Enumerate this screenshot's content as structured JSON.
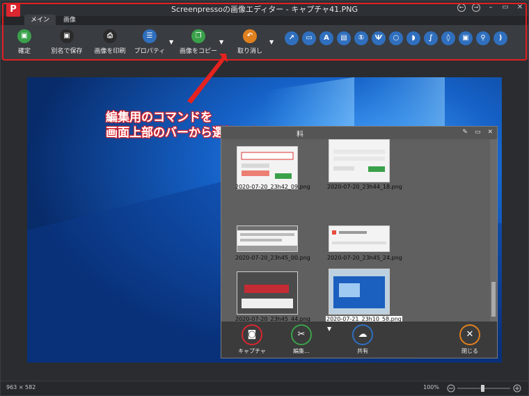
{
  "app": {
    "title": "Screenpressoの画像エディター - キャプチャ41.PNG",
    "logo_letter": "P"
  },
  "tabs": [
    {
      "label": "メイン"
    },
    {
      "label": "画像"
    }
  ],
  "ribbon": {
    "buttons": [
      {
        "label": "確定",
        "icon": "save-check-icon",
        "color": "#3aa14a"
      },
      {
        "label": "別名で保存",
        "icon": "save-as-icon",
        "color": "#2b2b2b"
      },
      {
        "label": "画像を印刷",
        "icon": "print-icon",
        "color": "#2b2b2b"
      },
      {
        "label": "プロパティ",
        "icon": "list-icon",
        "color": "#2f6fbe"
      },
      {
        "label": "画像をコピー",
        "icon": "copy-icon",
        "color": "#3aa14a"
      },
      {
        "label": "取り消し",
        "icon": "undo-icon",
        "color": "#e0801e"
      }
    ],
    "tools": [
      "arrow-tool-icon",
      "rectangle-tool-icon",
      "text-tool-icon",
      "callout-tool-icon",
      "step-tool-icon",
      "highlighter-tool-icon",
      "ellipse-tool-icon",
      "tag-tool-icon",
      "curve-tool-icon",
      "drop-tool-icon",
      "image-tool-icon",
      "magnifier-tool-icon",
      "bracket-tool-icon"
    ]
  },
  "callout": {
    "line1": "編集用のコマンドを",
    "line2": "画面上部のバーから選択します"
  },
  "inner_window": {
    "title": "料",
    "thumbnails": [
      {
        "caption": "2020-07-20_23h42_09.png"
      },
      {
        "caption": "2020-07-20_23h44_18.png"
      },
      {
        "caption": "2020-07-20_23h45_00.png"
      },
      {
        "caption": "2020-07-20_23h45_24.png"
      },
      {
        "caption": "2020-07-20_23h45_44.png"
      },
      {
        "caption": "2020-07-21_23h10_58.png"
      }
    ],
    "buttons": [
      {
        "label": "キャプチャ",
        "color": "#d8262f"
      },
      {
        "label": "編集...",
        "color": "#3aa14a"
      },
      {
        "label": "共有",
        "color": "#2f6fbe"
      },
      {
        "label": "閉じる",
        "color": "#e0801e"
      }
    ]
  },
  "status": {
    "dimensions": "963 × 582",
    "zoom": "100%"
  },
  "colors": {
    "highlight": "#e02020",
    "accent_red": "#d9262f"
  }
}
